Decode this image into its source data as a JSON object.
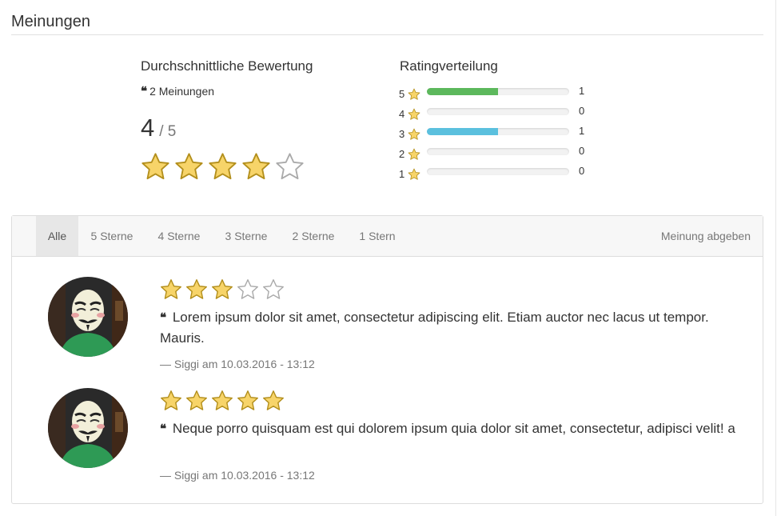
{
  "section": {
    "title": "Meinungen"
  },
  "average": {
    "heading": "Durchschnittliche Bewertung",
    "count_label": "2 Meinungen",
    "value": "4",
    "max": "/ 5",
    "stars_filled": 4,
    "stars_total": 5
  },
  "distribution": {
    "heading": "Ratingverteilung",
    "rows": [
      {
        "stars": "5",
        "count": "1",
        "fraction": 0.5,
        "color": "#5cb85c"
      },
      {
        "stars": "4",
        "count": "0",
        "fraction": 0.0,
        "color": "#5cb85c"
      },
      {
        "stars": "3",
        "count": "1",
        "fraction": 0.5,
        "color": "#5bc0de"
      },
      {
        "stars": "2",
        "count": "0",
        "fraction": 0.0,
        "color": "#f0ad4e"
      },
      {
        "stars": "1",
        "count": "0",
        "fraction": 0.0,
        "color": "#d9534f"
      }
    ]
  },
  "tabs": [
    {
      "label": "Alle",
      "active": true
    },
    {
      "label": "5 Sterne",
      "active": false
    },
    {
      "label": "4 Sterne",
      "active": false
    },
    {
      "label": "3 Sterne",
      "active": false
    },
    {
      "label": "2 Sterne",
      "active": false
    },
    {
      "label": "1 Stern",
      "active": false
    }
  ],
  "submit_label": "Meinung abgeben",
  "reviews": [
    {
      "rating": 3,
      "text": "Lorem ipsum dolor sit amet, consectetur adipiscing elit. Etiam auctor nec lacus ut tempor. Mauris.",
      "meta": "— Siggi am 10.03.2016 - 13:12"
    },
    {
      "rating": 5,
      "text": "Neque porro quisquam est qui dolorem ipsum quia dolor sit amet, consectetur, adipisci velit! a",
      "meta": "— Siggi am 10.03.2016 - 13:12"
    }
  ],
  "colors": {
    "star_fill": "#f7d469",
    "star_stroke": "#b38f1c",
    "star_empty_stroke": "#aaaaaa"
  }
}
